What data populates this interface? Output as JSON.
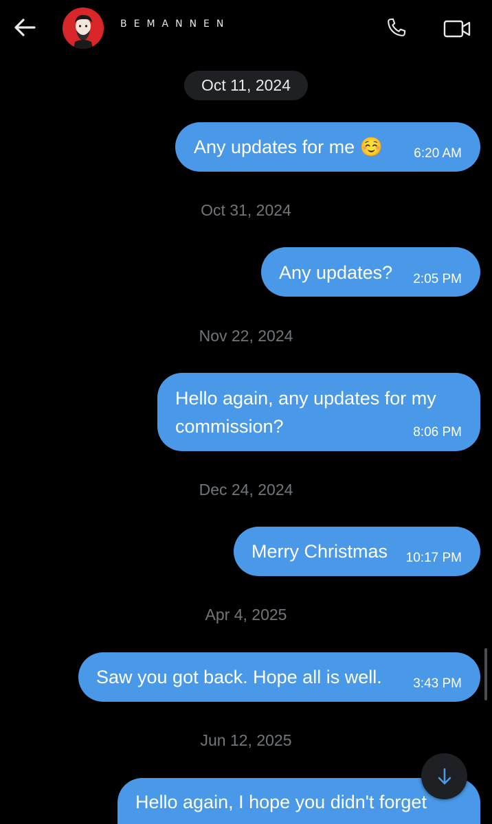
{
  "header": {
    "contact_name": "BEMANNEN",
    "back_icon": "arrow-left-icon",
    "call_icon": "phone-icon",
    "video_icon": "video-camera-icon"
  },
  "colors": {
    "background": "#000000",
    "bubble": "#4a99e9",
    "date_text": "#71767b",
    "date_pill": "#1f2023"
  },
  "conversation": [
    {
      "date": "Oct 11, 2024",
      "text": "Any updates for me ☺️",
      "time": "6:20 AM"
    },
    {
      "date": "Oct 31, 2024",
      "text": "Any updates?",
      "time": "2:05 PM"
    },
    {
      "date": "Nov 22, 2024",
      "text_line1": "Hello again, any updates for my",
      "text_line2": "commission?",
      "time": "8:06 PM"
    },
    {
      "date": "Dec 24, 2024",
      "text": "Merry Christmas",
      "time": "10:17 PM"
    },
    {
      "date": "Apr 4, 2025",
      "text": "Saw you got back. Hope all is well.",
      "time": "3:43 PM"
    },
    {
      "date": "Jun 12, 2025",
      "text": "Hello again, I hope you didn't forget"
    }
  ],
  "scroll_down_icon": "arrow-down-icon"
}
